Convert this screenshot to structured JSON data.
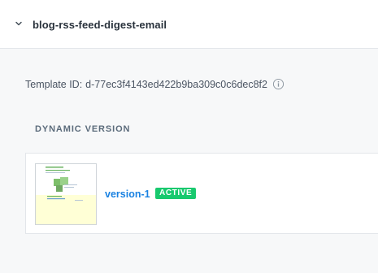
{
  "template": {
    "name": "blog-rss-feed-digest-email",
    "id_label": "Template ID:",
    "id_value": "d-77ec3f4143ed422b9ba309c0c6dec8f2"
  },
  "dynamic_version": {
    "heading": "DYNAMIC VERSION",
    "versions": [
      {
        "name": "version-1",
        "status": "ACTIVE"
      }
    ]
  },
  "icons": {
    "chevron": "chevron-down-icon",
    "info": "info-icon"
  },
  "colors": {
    "link": "#1a82e2",
    "badge_active": "#18c96e",
    "thumbnail_highlight": "#ffffd6"
  }
}
